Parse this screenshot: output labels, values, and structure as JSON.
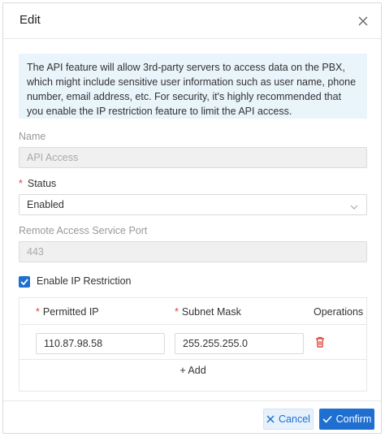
{
  "dialog": {
    "title": "Edit",
    "close_icon": "close-icon"
  },
  "alert": {
    "text": "The API feature will allow 3rd-party servers to access data on the PBX, which might include sensitive user information such as user name, phone number, email address, etc. For security, it's highly recommended that you enable the IP restriction feature to limit the API access."
  },
  "fields": {
    "name": {
      "label": "Name",
      "value": "API Access",
      "disabled": true
    },
    "status": {
      "label": "Status",
      "required_mark": "*",
      "value": "Enabled",
      "icon": "chevron-down-icon"
    },
    "port": {
      "label": "Remote Access Service Port",
      "value": "443",
      "disabled": true
    }
  },
  "ip_restriction": {
    "checkbox_label": "Enable IP Restriction",
    "checked": true
  },
  "table": {
    "headers": {
      "permitted_ip": "Permitted IP",
      "subnet_mask": "Subnet Mask",
      "operations": "Operations",
      "required_mark": "*"
    },
    "rows": [
      {
        "permitted_ip": "110.87.98.58",
        "subnet_mask": "255.255.255.0",
        "icon": "trash-icon"
      }
    ],
    "add_label": "+ Add"
  },
  "footer": {
    "cancel_label": "Cancel",
    "confirm_label": "Confirm"
  },
  "colors": {
    "primary": "#1f6fd0",
    "danger": "#e0433b",
    "alert_bg": "#e9f4fb"
  }
}
